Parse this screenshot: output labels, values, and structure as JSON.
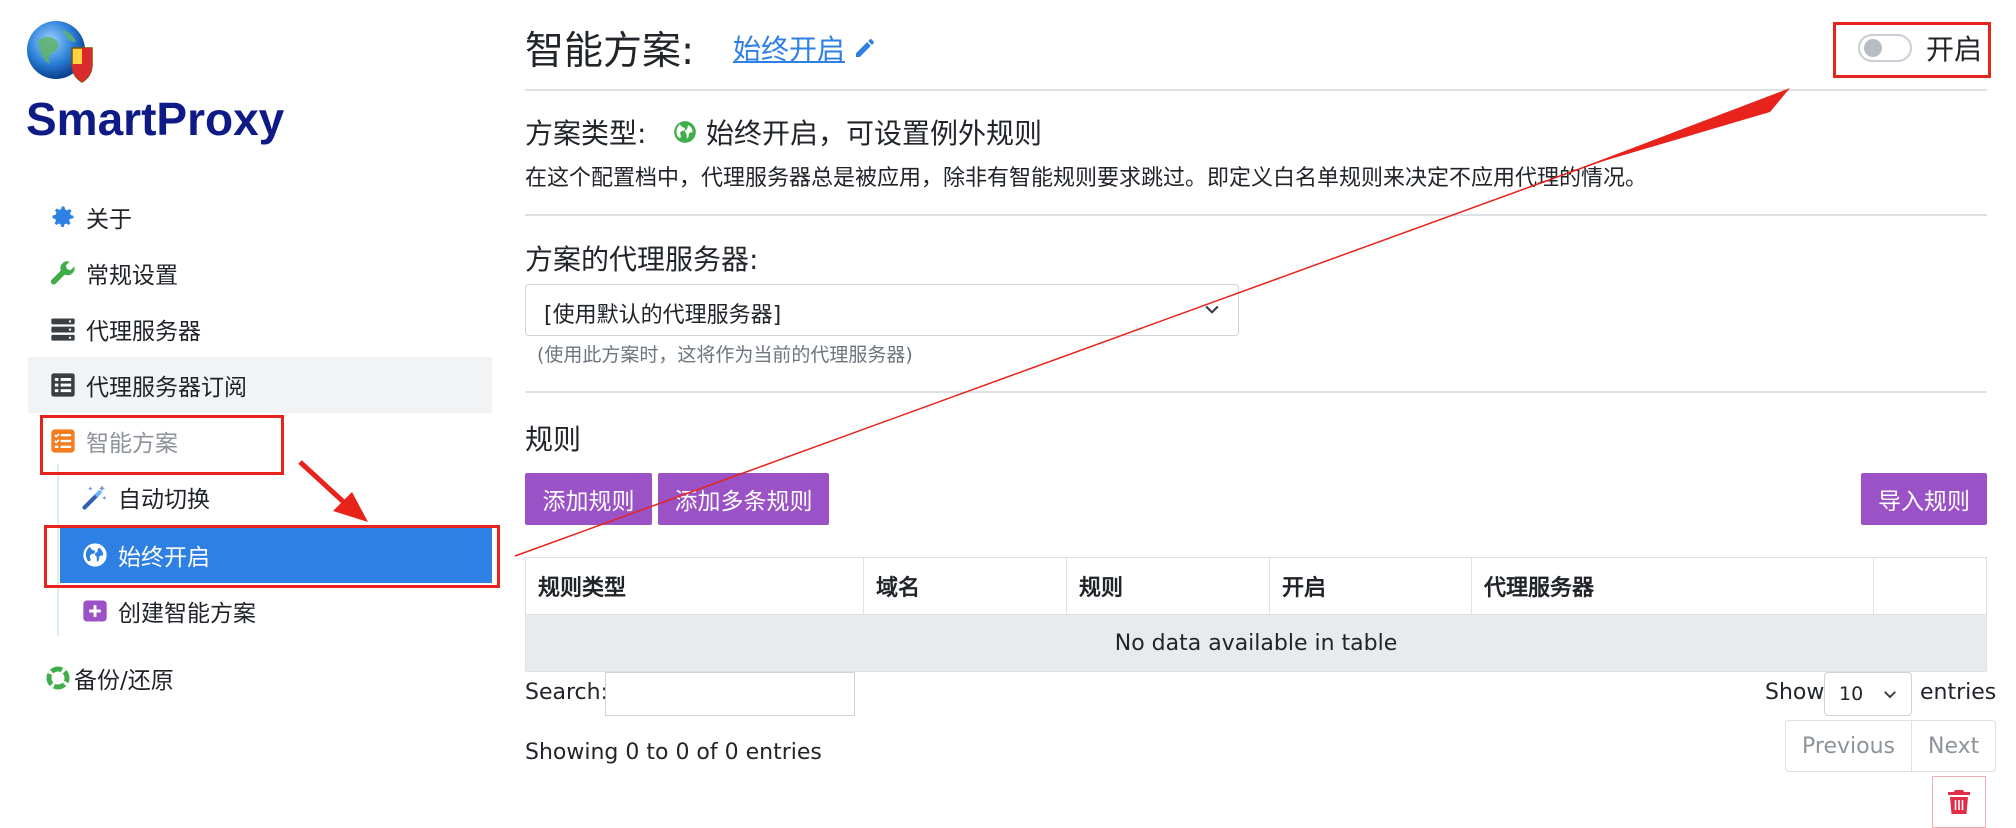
{
  "app": {
    "brand": "SmartProxy"
  },
  "sidebar": {
    "items": [
      {
        "label": "关于",
        "icon": "gear-icon"
      },
      {
        "label": "常规设置",
        "icon": "wrench-icon"
      },
      {
        "label": "代理服务器",
        "icon": "server-icon"
      },
      {
        "label": "代理服务器订阅",
        "icon": "list-icon"
      },
      {
        "label": "智能方案",
        "icon": "tasks-icon"
      },
      {
        "label": "自动切换",
        "icon": "magic-wand-icon"
      },
      {
        "label": "始终开启",
        "icon": "globe-icon"
      },
      {
        "label": "创建智能方案",
        "icon": "plus-square-icon"
      },
      {
        "label": "备份/还原",
        "icon": "lifebuoy-icon"
      }
    ]
  },
  "header": {
    "title": "智能方案:",
    "profile_link": "始终开启",
    "toggle_label": "开启",
    "toggle_on": false
  },
  "profile_type": {
    "label": "方案类型:",
    "value": "始终开启，可设置例外规则",
    "description": "在这个配置档中，代理服务器总是被应用，除非有智能规则要求跳过。即定义白名单规则来决定不应用代理的情况。"
  },
  "proxy_server": {
    "label": "方案的代理服务器:",
    "selected": "[使用默认的代理服务器]",
    "helper": "(使用此方案时，这将作为当前的代理服务器)"
  },
  "rules": {
    "heading": "规则",
    "add_rule": "添加规则",
    "add_multiple_rules": "添加多条规则",
    "import_rules": "导入规则",
    "columns": [
      "规则类型",
      "域名",
      "规则",
      "开启",
      "代理服务器",
      ""
    ],
    "empty_text": "No data available in table",
    "search_label": "Search:",
    "search_value": "",
    "show_label": "Show",
    "page_length": "10",
    "entries_label": "entries",
    "info": "Showing 0 to 0 of 0 entries",
    "previous": "Previous",
    "next": "Next"
  },
  "colors": {
    "accent": "#2f80e4",
    "purple_button": "#9b52c6",
    "brand": "#0e1a85",
    "annotation_red": "#e8231b",
    "danger": "#e02d48"
  }
}
